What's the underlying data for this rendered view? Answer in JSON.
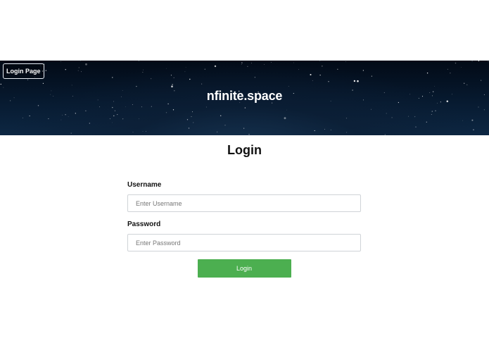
{
  "header": {
    "page_tag": "Login Page",
    "site_title": "nfinite.space",
    "background": "starry night sky"
  },
  "main": {
    "heading": "Login",
    "username": {
      "label": "Username",
      "placeholder": "Enter Username",
      "value": ""
    },
    "password": {
      "label": "Password",
      "placeholder": "Enter Password",
      "value": ""
    },
    "submit_label": "Login"
  },
  "colors": {
    "banner_dark": "#06162a",
    "button": "#4caf50",
    "text": "#111111",
    "input_border": "#cfd3d7"
  }
}
